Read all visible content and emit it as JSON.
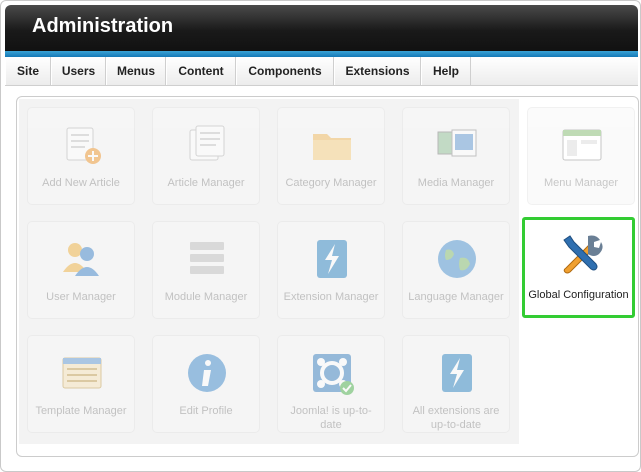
{
  "header": {
    "title": "Administration"
  },
  "menu": [
    {
      "label": "Site",
      "w": 46
    },
    {
      "label": "Users",
      "w": 55
    },
    {
      "label": "Menus",
      "w": 60
    },
    {
      "label": "Content",
      "w": 70
    },
    {
      "label": "Components",
      "w": 98
    },
    {
      "label": "Extensions",
      "w": 87
    },
    {
      "label": "Help",
      "w": 50
    }
  ],
  "tiles": [
    {
      "label": "Add New Article",
      "icon": "add-article-icon"
    },
    {
      "label": "Article Manager",
      "icon": "article-manager-icon"
    },
    {
      "label": "Category Manager",
      "icon": "folder-icon"
    },
    {
      "label": "Media Manager",
      "icon": "media-icon"
    },
    {
      "label": "Menu Manager",
      "icon": "menu-manager-icon"
    },
    {
      "label": "User Manager",
      "icon": "users-icon"
    },
    {
      "label": "Module Manager",
      "icon": "module-icon"
    },
    {
      "label": "Extension Manager",
      "icon": "extension-icon"
    },
    {
      "label": "Language Manager",
      "icon": "globe-icon"
    },
    {
      "label": "Global Configuration",
      "icon": "tools-icon"
    },
    {
      "label": "Template Manager",
      "icon": "template-icon"
    },
    {
      "label": "Edit Profile",
      "icon": "info-icon"
    },
    {
      "label": "Joomla! is up-to-date",
      "icon": "joomla-check-icon"
    },
    {
      "label": "All extensions are up-to-date",
      "icon": "extension-update-icon"
    }
  ],
  "colors": {
    "highlight": "#33cc33",
    "header": "#1a1a1a",
    "accent": "#1478b6"
  }
}
